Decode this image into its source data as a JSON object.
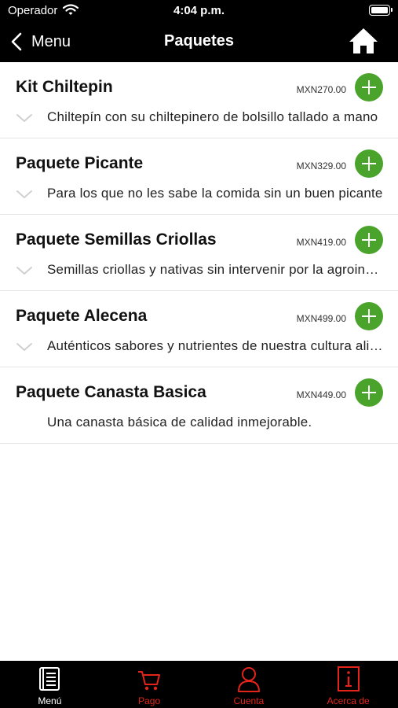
{
  "status": {
    "carrier": "Operador",
    "time": "4:04 p.m."
  },
  "nav": {
    "back_label": "Menu",
    "title": "Paquetes"
  },
  "colors": {
    "accent_green": "#4aa42b",
    "tab_active": "#ffffff",
    "tab_inactive": "#e3241b",
    "bar_bg": "#000000"
  },
  "items": [
    {
      "title": "Kit Chiltepin",
      "price": "MXN270.00",
      "description": "Chiltepín con su chiltepinero de bolsillo tallado a mano",
      "expandable": true
    },
    {
      "title": "Paquete Picante",
      "price": "MXN329.00",
      "description": "Para los que no les sabe la comida sin un buen picante",
      "expandable": true
    },
    {
      "title": "Paquete Semillas Criollas",
      "price": "MXN419.00",
      "description": "Semillas criollas y nativas sin intervenir por la agroindustria",
      "expandable": true
    },
    {
      "title": "Paquete Alecena",
      "price": "MXN499.00",
      "description": "Auténticos sabores y nutrientes de nuestra cultura alimentaria",
      "expandable": true
    },
    {
      "title": "Paquete Canasta Basica",
      "price": "MXN449.00",
      "description": "Una canasta básica de calidad inmejorable.",
      "expandable": false
    }
  ],
  "tabs": [
    {
      "label": "Menú",
      "icon": "book-icon",
      "active": true
    },
    {
      "label": "Pago",
      "icon": "cart-icon",
      "active": false
    },
    {
      "label": "Cuenta",
      "icon": "user-icon",
      "active": false
    },
    {
      "label": "Acerca de",
      "icon": "info-icon",
      "active": false
    }
  ]
}
